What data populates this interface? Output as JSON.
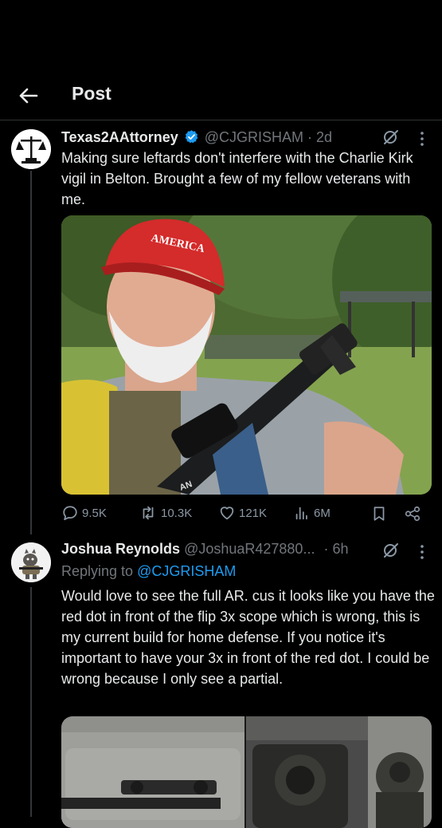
{
  "header": {
    "title": "Post"
  },
  "post": {
    "display_name": "Texas2AAttorney",
    "handle": "@CJGRISHAM",
    "time": "· 2d",
    "text": "Making sure leftards don't interfere with the Charlie Kirk vigil in Belton. Brought a few of my fellow veterans with me.",
    "image_text": {
      "hat": "AMERICA",
      "rifle": "AN"
    },
    "stats": {
      "replies": "9.5K",
      "reposts": "10.3K",
      "likes": "121K",
      "views": "6M"
    }
  },
  "reply": {
    "display_name": "Joshua Reynolds",
    "handle": "@JoshuaR427880...",
    "time": "· 6h",
    "replying_prefix": "Replying to",
    "replying_to": "@CJGRISHAM",
    "text": "Would love to see the full AR. cus it looks like you have the red dot in front of the flip 3x scope which is wrong, this is my current build for home defense. If you notice it's important to have your 3x in front of the red dot. I could be wrong because I only see a partial."
  },
  "colors": {
    "background": "#000000",
    "accent": "#1d9bf0",
    "text": "#e7e9ea",
    "secondary": "#71767b",
    "verified": "#1d9bf0"
  },
  "icons": [
    "back-arrow-icon",
    "verified-badge-icon",
    "grok-icon",
    "more-icon",
    "reply-icon",
    "repost-icon",
    "like-icon",
    "views-icon",
    "bookmark-icon",
    "share-icon"
  ]
}
